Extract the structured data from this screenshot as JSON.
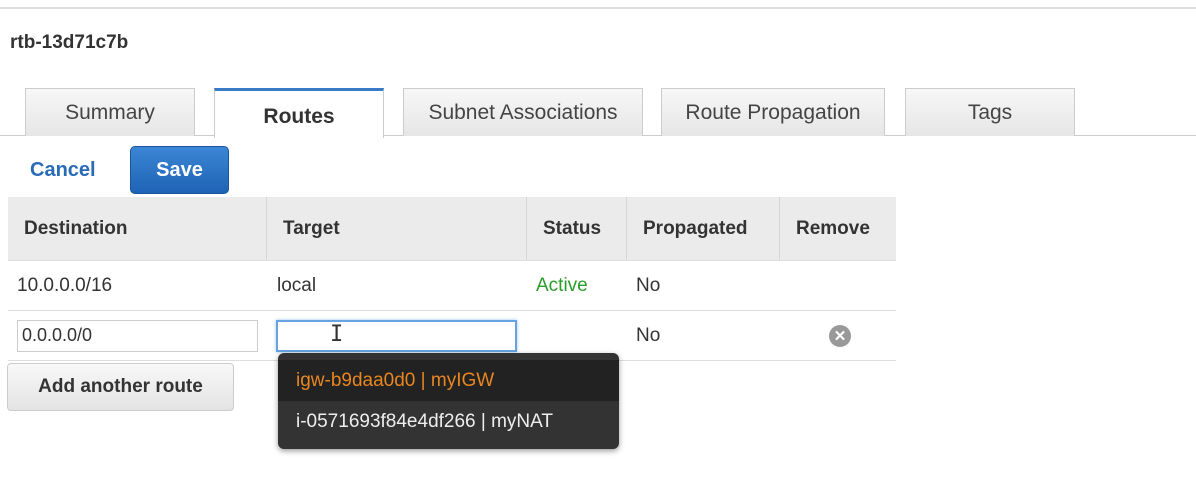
{
  "title": "rtb-13d71c7b",
  "tabs": [
    "Summary",
    "Routes",
    "Subnet Associations",
    "Route Propagation",
    "Tags"
  ],
  "actions": {
    "cancel": "Cancel",
    "save": "Save"
  },
  "table": {
    "headers": [
      "Destination",
      "Target",
      "Status",
      "Propagated",
      "Remove"
    ],
    "rows": [
      {
        "destination": "10.0.0.0/16",
        "target": "local",
        "status": "Active",
        "propagated": "No"
      },
      {
        "destination": "0.0.0.0/0",
        "target": "",
        "propagated": "No",
        "remove_icon": "remove-circle-icon"
      }
    ]
  },
  "add_route": "Add another route",
  "dropdown": {
    "options": [
      "igw-b9daa0d0 | myIGW",
      "i-0571693f84e4df266 | myNAT"
    ]
  },
  "colors": {
    "accent": "#2a6bb8",
    "status_active": "#2a9d2a",
    "highlight": "#e8861f"
  }
}
